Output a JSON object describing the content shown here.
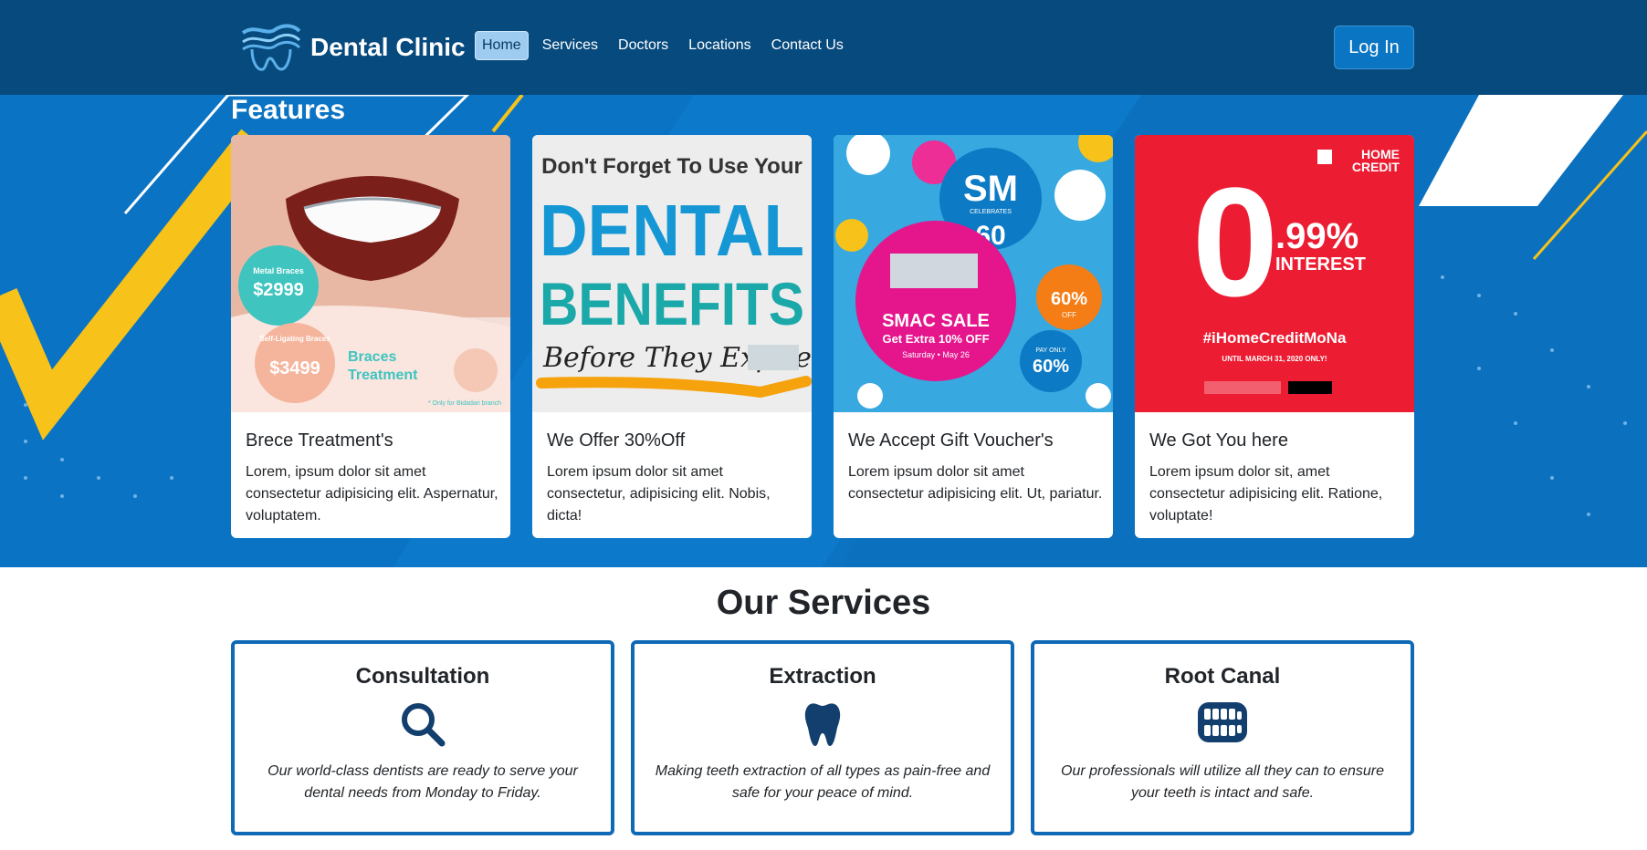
{
  "header": {
    "brand": "Dental Clinic",
    "nav": [
      "Home",
      "Services",
      "Doctors",
      "Locations",
      "Contact Us"
    ],
    "login": "Log In"
  },
  "features": {
    "title": "Features",
    "cards": [
      {
        "title": "Brece Treatment's",
        "text": "Lorem, ipsum dolor sit amet consectetur adipisicing elit. Aspernatur, voluptatem.",
        "image": {
          "price1_label": "Metal Braces",
          "price1": "$2999",
          "price2_label": "Self-Ligating Braces",
          "price2": "$3499",
          "headline": "Braces Treatment",
          "note": "* Only for Bidadari branch"
        }
      },
      {
        "title": "We Offer 30%Off",
        "text": "Lorem ipsum dolor sit amet consectetur, adipisicing elit. Nobis, dicta!",
        "image": {
          "line1": "Don't Forget To Use Your",
          "line2": "DENTAL",
          "line3": "BENEFITS",
          "line4": "Before They Expire!"
        }
      },
      {
        "title": "We Accept Gift Voucher's",
        "text": "Lorem ipsum dolor sit amet consectetur adipisicing elit. Ut, pariatur.",
        "image": {
          "logo": "SM",
          "logo_sub": "CELEBRATES",
          "logo_num": "60",
          "headline": "SMAC SALE",
          "subline": "Get Extra 10% OFF",
          "date": "Saturday • May 26",
          "badge1": "60%",
          "badge1_sub": "OFF",
          "badge2": "60%",
          "badge2_top": "PAY ONLY"
        }
      },
      {
        "title": "We Got You here",
        "text": "Lorem ipsum dolor sit, amet consectetur adipisicing elit. Ratione, voluptate!",
        "image": {
          "brand": "HOME CREDIT",
          "big": "0",
          "rate": ".99%",
          "interest": "INTEREST",
          "hashtag": "#iHomeCreditMoNa",
          "until": "UNTIL MARCH 31, 2020 ONLY!"
        }
      }
    ]
  },
  "services": {
    "title": "Our Services",
    "items": [
      {
        "title": "Consultation",
        "text": "Our world-class dentists are ready to serve your dental needs from Monday to Friday.",
        "icon": "search-icon"
      },
      {
        "title": "Extraction",
        "text": "Making teeth extraction of all types as pain-free and safe for your peace of mind.",
        "icon": "tooth-icon"
      },
      {
        "title": "Root Canal",
        "text": "Our professionals will utilize all they can to ensure your teeth is intact and safe.",
        "icon": "teeth-icon"
      }
    ]
  },
  "colors": {
    "nav_bg": "#074a7e",
    "hero_bg": "#0a73c3",
    "accent_yellow": "#f7c21a",
    "service_border": "#0f69b4"
  }
}
